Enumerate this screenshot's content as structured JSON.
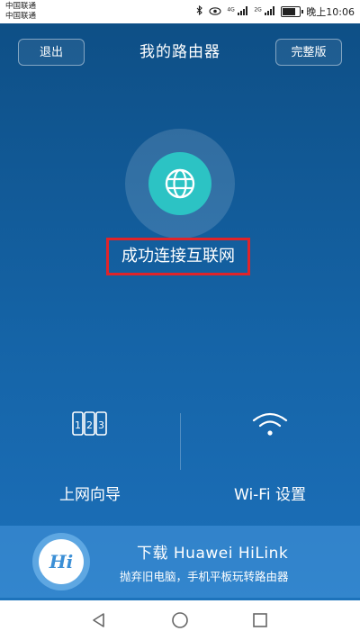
{
  "status_bar": {
    "carrier_1": "中国联通",
    "carrier_2": "中国联通",
    "network_1": "4G",
    "network_2": "2G",
    "time": "晚上10:06",
    "battery_level": 0.85
  },
  "header": {
    "exit_label": "退出",
    "title": "我的路由器",
    "full_version_label": "完整版"
  },
  "connection": {
    "status_text": "成功连接互联网",
    "icon": "globe-icon",
    "highlight_color": "#e0242a"
  },
  "quick_actions": [
    {
      "label": "上网向导",
      "icon": "setup-wizard-123-icon"
    },
    {
      "label": "Wi-Fi 设置",
      "icon": "wifi-icon"
    }
  ],
  "banner": {
    "logo_text": "Hi",
    "title": "下载 Huawei HiLink",
    "subtitle": "抛弃旧电脑，手机平板玩转路由器"
  },
  "nav": {
    "back_icon": "back-triangle-icon",
    "home_icon": "home-circle-icon",
    "recent_icon": "recent-square-icon"
  },
  "colors": {
    "background_top": "#0e4f86",
    "background_bottom": "#1d73bb",
    "globe": "#2cc3c4"
  }
}
